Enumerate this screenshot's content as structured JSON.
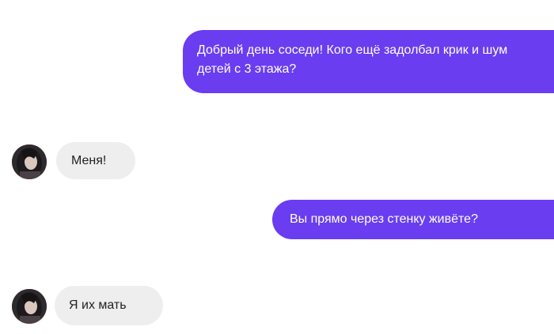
{
  "messages": [
    {
      "direction": "outgoing",
      "text": "Добрый день соседи! Кого ещё задолбал крик и шум детей с 3 этажа?"
    },
    {
      "direction": "incoming",
      "text": "Меня!"
    },
    {
      "direction": "outgoing",
      "text": "Вы прямо через стенку живёте?"
    },
    {
      "direction": "incoming",
      "text": "Я их мать"
    }
  ],
  "colors": {
    "outgoing_bubble": "#6a3df0",
    "incoming_bubble": "#eeeeee",
    "background": "#ffffff"
  },
  "icons": {
    "contact_avatar": "avatar-photo"
  }
}
